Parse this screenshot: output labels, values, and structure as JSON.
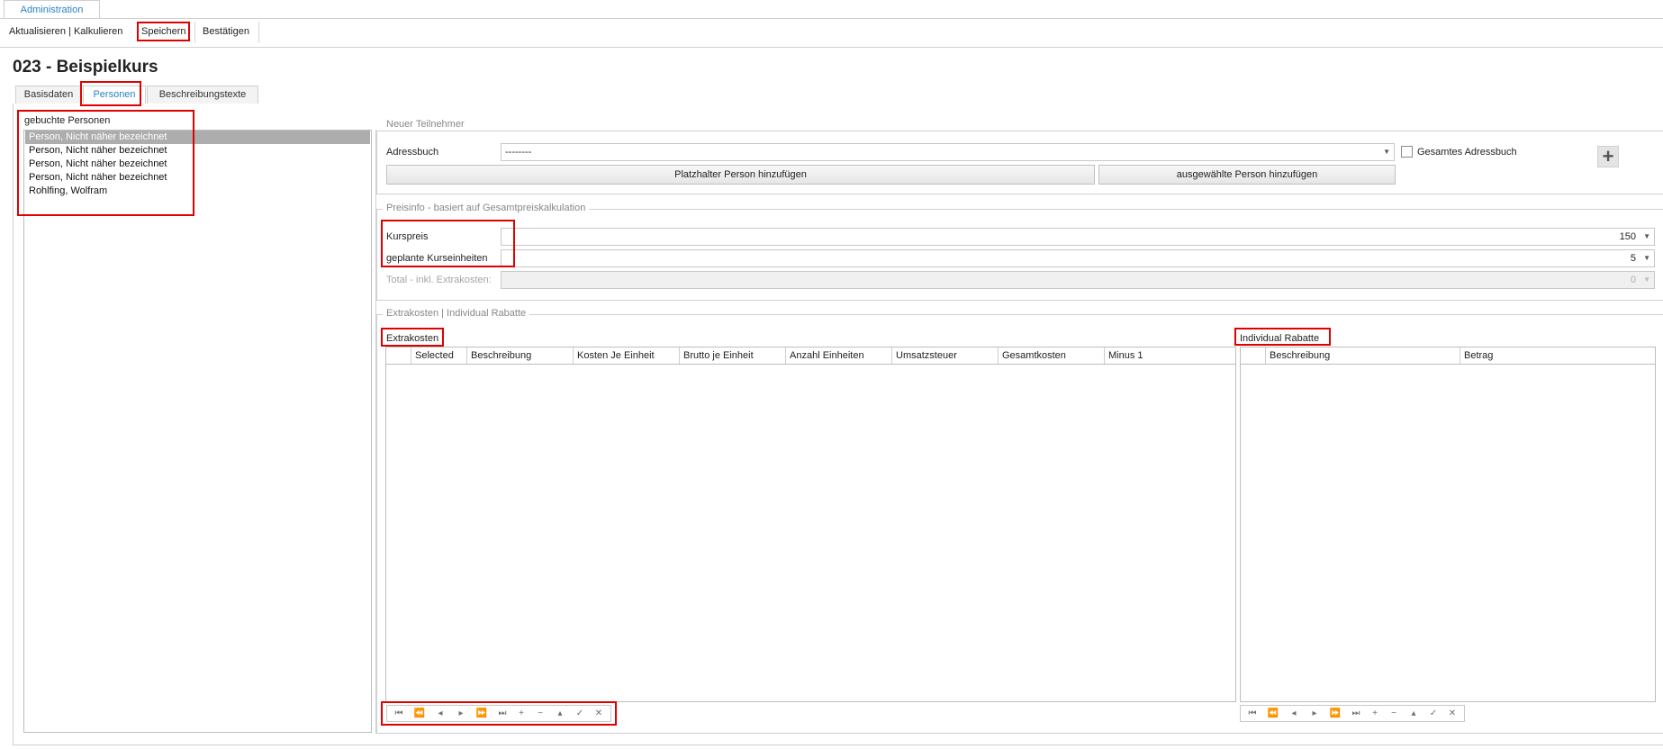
{
  "ribbon": {
    "tab": "Administration",
    "buttons": [
      "Aktualisieren | Kalkulieren",
      "Speichern",
      "Bestätigen"
    ]
  },
  "page_title": "023 - Beispielkurs",
  "tabs": [
    "Basisdaten",
    "Personen",
    "Beschreibungstexte"
  ],
  "booked": {
    "title": "gebuchte Personen",
    "items": [
      "Person, Nicht näher bezeichnet",
      "Person, Nicht näher bezeichnet",
      "Person, Nicht näher bezeichnet",
      "Person, Nicht näher bezeichnet",
      "Rohlfing, Wolfram"
    ]
  },
  "new_participant": {
    "title": "Neuer Teilnehmer",
    "adressbuch_label": "Adressbuch",
    "adressbuch_value": "--------",
    "gesamtes_label": "Gesamtes Adressbuch",
    "placeholder_button": "Platzhalter Person hinzufügen",
    "selected_button": "ausgewählte Person hinzufügen",
    "add_icon": "plus-icon"
  },
  "price": {
    "title": "Preisinfo - basiert auf Gesamtpreiskalkulation",
    "kurspreis_label": "Kurspreis",
    "kurspreis_value": "150",
    "units_label": "geplante Kurseinheiten",
    "units_value": "5",
    "total_label": "Total - inkl. Extrakosten:",
    "total_value": "0"
  },
  "extras": {
    "title": "Extrakosten | Individual Rabatte",
    "extrakosten_label": "Extrakosten",
    "extrakosten_columns": [
      "Selected",
      "Beschreibung",
      "Kosten Je Einheit",
      "Brutto je Einheit",
      "Anzahl Einheiten",
      "Umsatzsteuer",
      "Gesamtkosten",
      "Minus 1"
    ],
    "rabatte_label": "Individual Rabatte",
    "rabatte_columns": [
      "Beschreibung",
      "Betrag"
    ]
  },
  "navigator": {
    "icons": [
      "⏮",
      "⏪",
      "◂",
      "▸",
      "⏩",
      "⏭",
      "+",
      "−",
      "▴",
      "✓",
      "✕"
    ]
  },
  "colors": {
    "accent": "#2a82c6",
    "highlight": "#e00000",
    "selection": "#adadad"
  }
}
